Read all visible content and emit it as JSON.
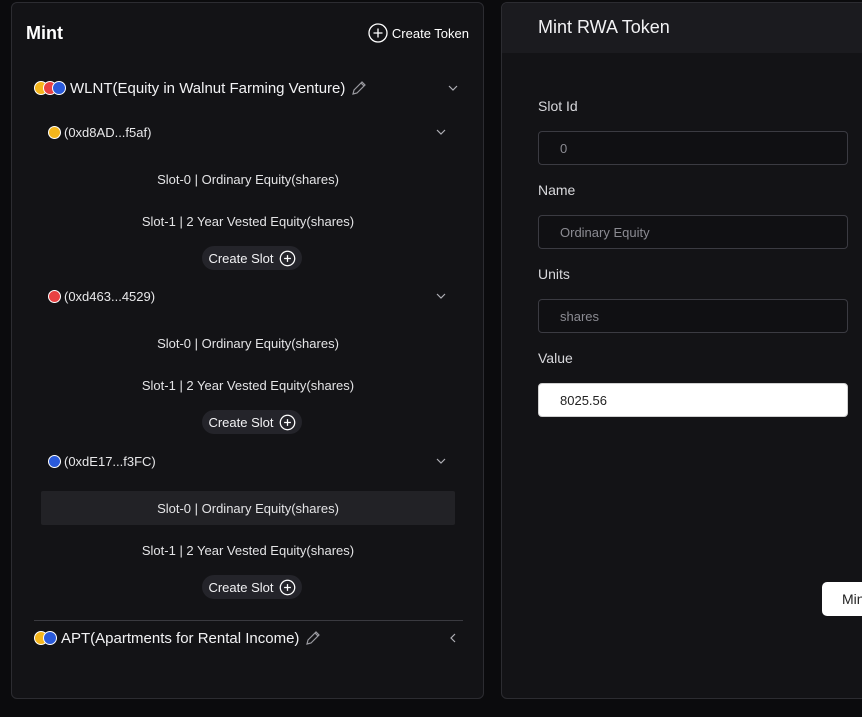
{
  "left_panel": {
    "title": "Mint",
    "create_token_label": "Create Token"
  },
  "tokens": [
    {
      "name": "WLNT(Equity in Walnut Farming Venture)",
      "icons": [
        "yellow-coin-icon",
        "red-coin-icon",
        "blue-coin-icon"
      ],
      "expanded": true,
      "chains": [
        {
          "address": "(0xd8AD...f5af)",
          "icon": "yellow-coin-icon",
          "slots": [
            "Slot-0 | Ordinary Equity(shares)",
            "Slot-1 | 2 Year Vested Equity(shares)"
          ],
          "create_slot_label": "Create Slot"
        },
        {
          "address": "(0xd463...4529)",
          "icon": "red-coin-icon",
          "slots": [
            "Slot-0 | Ordinary Equity(shares)",
            "Slot-1 | 2 Year Vested Equity(shares)"
          ],
          "create_slot_label": "Create Slot"
        },
        {
          "address": "(0xdE17...f3FC)",
          "icon": "blue-coin-icon",
          "slots": [
            "Slot-0 | Ordinary Equity(shares)",
            "Slot-1 | 2 Year Vested Equity(shares)"
          ],
          "create_slot_label": "Create Slot"
        }
      ]
    },
    {
      "name": "APT(Apartments for Rental Income)",
      "icons": [
        "yellow-coin-icon",
        "blue-coin-icon"
      ],
      "expanded": false
    }
  ],
  "right_panel": {
    "title": "Mint RWA Token",
    "fields": [
      {
        "label": "Slot Id",
        "value": "0"
      },
      {
        "label": "Name",
        "value": "Ordinary Equity"
      },
      {
        "label": "Units",
        "value": "shares"
      },
      {
        "label": "Value",
        "value": "8025.56"
      }
    ],
    "mint_button_label": "Mint"
  },
  "colors": {
    "yellow_coin": "#f5b61c",
    "red_coin": "#e84142",
    "blue_coin": "#2a5ada",
    "panel_bg": "#131316"
  }
}
